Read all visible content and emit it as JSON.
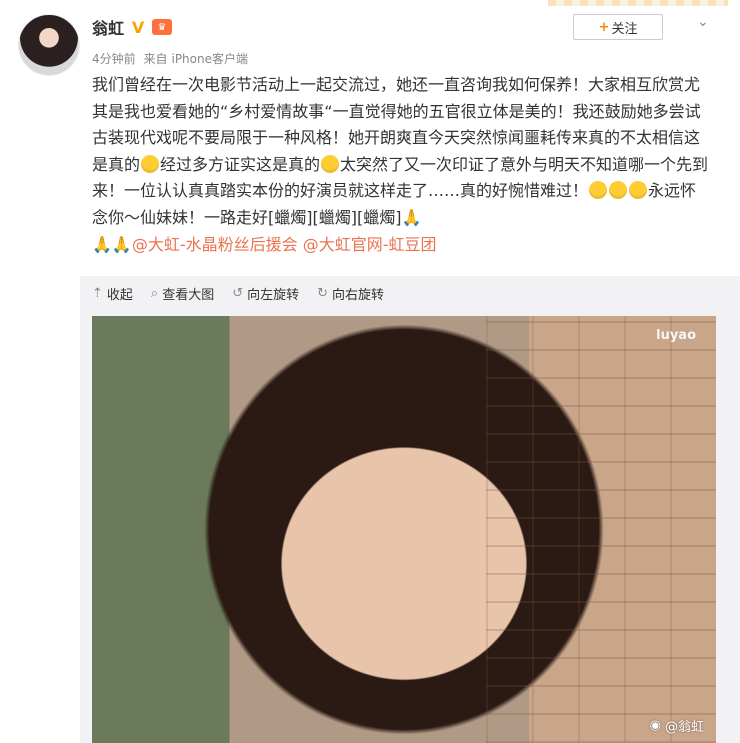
{
  "user": {
    "name": "翁虹",
    "time": "4分钟前",
    "source_prefix": "来自",
    "source": "iPhone客户端"
  },
  "header": {
    "follow_label": "关注",
    "follow_plus": "+",
    "more_icon": "chevron-down-icon"
  },
  "post": {
    "line1": "我们曾经在一次电影节活动上一起交流过，她还一直咨询我如何保养！大家相互欣赏尤其是我也爱看她的“乡村爱情故事“一直觉得她的五官很立体是美的！我还鼓励她多尝试古装现代戏呢不要局限于一种风格！她开朗爽直今天突然惊闻噩耗传来真的不太相信这是真的",
    "line2": "经过多方证实这是真的",
    "line3": "太突然了又一次印证了意外与明天不知道哪一个先到来！一位认认真真踏实本份的好演员就这样走了……真的好惋惜难过！",
    "line4": "永远怀念你～仙妹妹！一路走好[蠟燭][蠟燭][蠟燭]",
    "pray": "🙏",
    "mention1": "@大虹-水晶粉丝后援会",
    "mention2": "@大虹官网-虹豆团"
  },
  "toolbar": {
    "collapse": "收起",
    "view_large": "查看大图",
    "rotate_left": "向左旋转",
    "rotate_right": "向右旋转"
  },
  "photo": {
    "watermark_top": "luyao",
    "watermark_bottom": "@翁虹"
  }
}
